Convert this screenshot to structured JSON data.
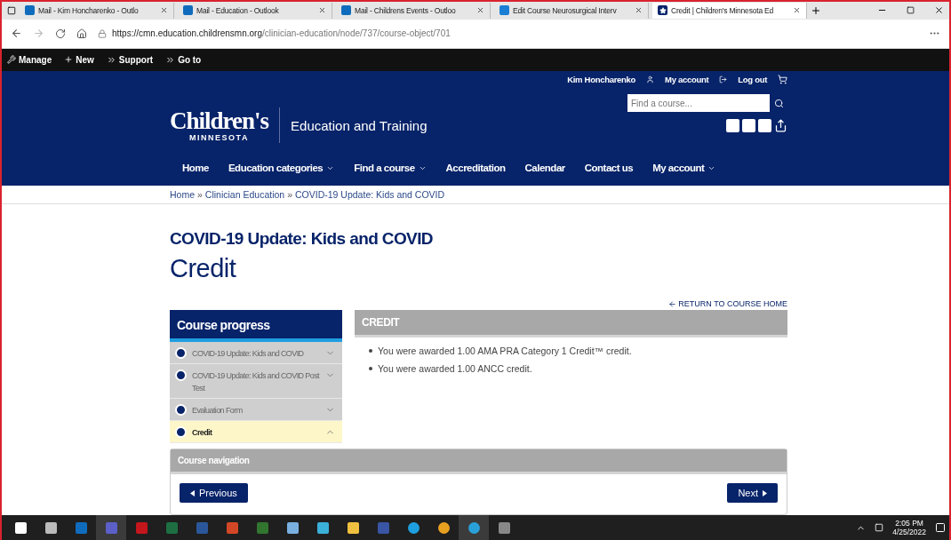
{
  "browser": {
    "tabs": [
      {
        "title": "Mail - Kim Honcharenko - Outlo",
        "kind": "mail",
        "selected": false
      },
      {
        "title": "Mail - Education - Outlook",
        "kind": "mail",
        "selected": false
      },
      {
        "title": "Mail - Childrens Events - Outloo",
        "kind": "mail",
        "selected": false
      },
      {
        "title": "Edit Course Neurosurgical Interv",
        "kind": "edge",
        "selected": false
      },
      {
        "title": "Credit | Children's Minnesota Ed",
        "kind": "star",
        "selected": true
      }
    ],
    "url_host": "https://cmn.education.childrensmn.org",
    "url_path": "/clinician-education/node/737/course-object/701"
  },
  "admin_toolbar": [
    {
      "label": "Manage",
      "kind": "wrench"
    },
    {
      "label": "New",
      "kind": "plus"
    },
    {
      "label": "Support",
      "kind": "chevrons"
    },
    {
      "label": "Go to",
      "kind": "chevrons"
    }
  ],
  "header": {
    "user": "Kim Honcharenko",
    "my_account": "My account",
    "log_out": "Log out",
    "logo_name": "Children's",
    "logo_sub": "MINNESOTA",
    "site_title": "Education and Training",
    "search": {
      "placeholder": "Find a course..."
    }
  },
  "nav": [
    {
      "label": "Home",
      "dropdown": false
    },
    {
      "label": "Education categories",
      "dropdown": true
    },
    {
      "label": "Find a course",
      "dropdown": true
    },
    {
      "label": "Accreditation",
      "dropdown": false
    },
    {
      "label": "Calendar",
      "dropdown": false
    },
    {
      "label": "Contact us",
      "dropdown": false
    },
    {
      "label": "My account",
      "dropdown": true
    }
  ],
  "breadcrumb": {
    "separator": "»",
    "items": [
      "Home",
      "Clinician Education",
      "COVID-19 Update: Kids and COVID"
    ]
  },
  "course_title": "COVID-19 Update: Kids and COVID",
  "page_title": "Credit",
  "return_link": "RETURN TO COURSE HOME",
  "progress": {
    "title": "Course progress",
    "items": [
      {
        "label": "COVID-19 Update: Kids and COVID",
        "selected": false,
        "expanded": false
      },
      {
        "label": "COVID-19 Update: Kids and COVID Post Test",
        "selected": false,
        "expanded": false
      },
      {
        "label": "Evaluation Form",
        "selected": false,
        "expanded": false
      },
      {
        "label": "Credit",
        "selected": true,
        "expanded": true
      }
    ]
  },
  "credit": {
    "title": "CREDIT",
    "lines": [
      "You were awarded 1.00 AMA PRA Category 1 Credit™ credit.",
      "You were awarded 1.00 ANCC credit."
    ]
  },
  "course_navigation": {
    "title": "Course navigation",
    "previous": "Previous",
    "next": "Next"
  },
  "taskbar": {
    "apps": [
      {
        "kind": "taskview",
        "selected": false
      },
      {
        "kind": "outlook",
        "selected": false
      },
      {
        "kind": "teams",
        "selected": true
      },
      {
        "kind": "acrobat",
        "selected": false
      },
      {
        "kind": "excel",
        "selected": false
      },
      {
        "kind": "word",
        "selected": false
      },
      {
        "kind": "powerpoint",
        "selected": false
      },
      {
        "kind": "project",
        "selected": false
      },
      {
        "kind": "network",
        "selected": false
      },
      {
        "kind": "search",
        "selected": false
      },
      {
        "kind": "folder",
        "selected": false
      },
      {
        "kind": "visio",
        "selected": false
      },
      {
        "kind": "ie",
        "selected": false
      },
      {
        "kind": "chrome",
        "selected": false
      },
      {
        "kind": "edge",
        "selected": true
      },
      {
        "kind": "calculator",
        "selected": false
      }
    ],
    "time": "2:05 PM",
    "date": "4/25/2022"
  }
}
